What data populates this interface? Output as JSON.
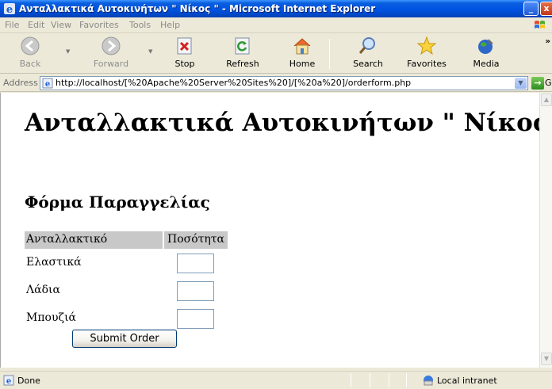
{
  "window": {
    "title": "Ανταλλακτικά Αυτοκινήτων \" Νίκος \" - Microsoft Internet Explorer",
    "minimize_glyph": "_",
    "close_glyph": "x"
  },
  "menu": [
    "File",
    "Edit",
    "View",
    "Favorites",
    "Tools",
    "Help"
  ],
  "toolbar": {
    "back": "Back",
    "forward": "Forward",
    "stop": "Stop",
    "refresh": "Refresh",
    "home": "Home",
    "search": "Search",
    "favorites": "Favorites",
    "media": "Media",
    "more": "»"
  },
  "address": {
    "label": "Address",
    "url": "http://localhost/[%20Apache%20Server%20Sites%20]/[%20a%20]/orderform.php",
    "go_label": "Go",
    "go_glyph": "→",
    "dropdown_glyph": "▼"
  },
  "page": {
    "title": "Ανταλλακτικά Αυτοκινήτων \" Νίκος \"",
    "form_title": "Φόρμα Παραγγελίας",
    "table": {
      "headers": [
        "Ανταλλακτικό",
        "Ποσότητα"
      ],
      "rows": [
        {
          "part": "Ελαστικά",
          "qty": ""
        },
        {
          "part": "Λάδια",
          "qty": ""
        },
        {
          "part": "Μπουζιά",
          "qty": ""
        }
      ]
    },
    "submit_label": "Submit Order"
  },
  "scrollbar": {
    "up_glyph": "▲",
    "down_glyph": "▼"
  },
  "status": {
    "text": "Done",
    "zone": "Local intranet"
  },
  "colors": {
    "titlebar": "#0054e3",
    "table_header_bg": "#c8c8c8",
    "content_bg": "#ffffff"
  }
}
